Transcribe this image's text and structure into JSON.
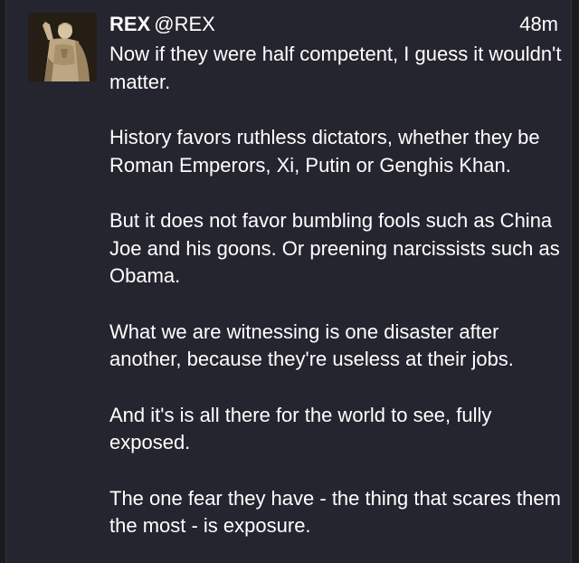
{
  "post": {
    "author_name": "REX",
    "author_handle": "@REX",
    "timestamp": "48m",
    "avatar_icon": "statue-avatar-icon",
    "paragraphs": [
      "Now if they were half competent, I guess it wouldn't matter.",
      "History favors ruthless dictators, whether they be Roman Emperors, Xi, Putin or Genghis Khan.",
      "But it does not favor bumbling fools such as China Joe and his goons. Or preening narcissists such as Obama.",
      "What we are witnessing is one disaster after another, because they're useless at their jobs.",
      "And it's is all there for the world to see, fully exposed.",
      "The one fear they have - the thing that scares them the most - is exposure."
    ]
  },
  "colors": {
    "background": "#25252f",
    "text": "#ffffff"
  }
}
